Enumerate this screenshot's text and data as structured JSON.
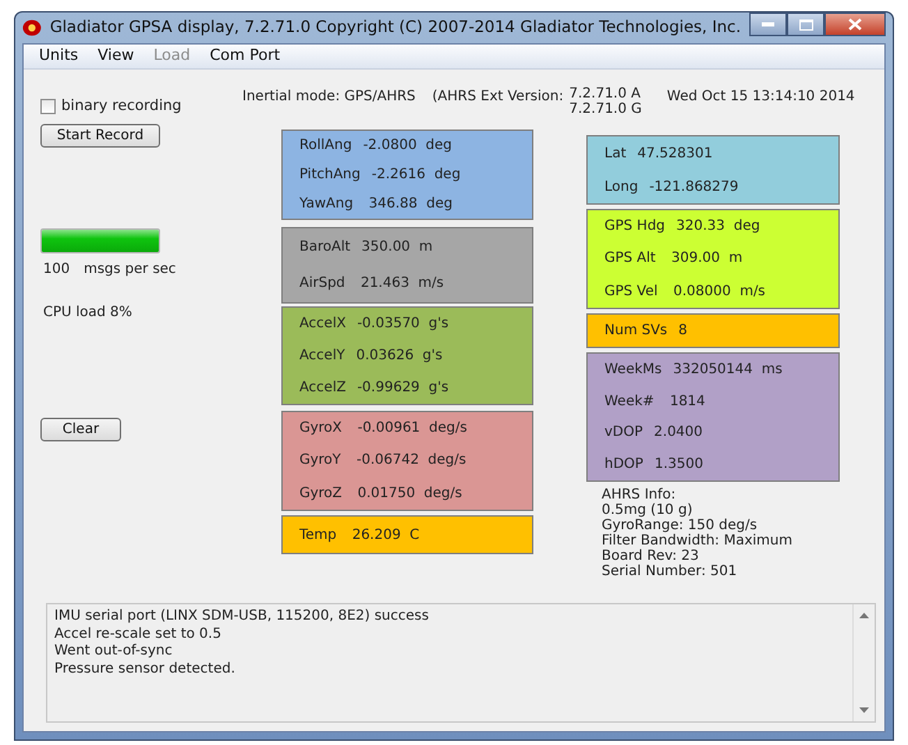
{
  "window": {
    "title": "Gladiator GPSA display, 7.2.71.0 Copyright (C) 2007-2014 Gladiator Technologies, Inc."
  },
  "menu": [
    {
      "label": "Units",
      "disabled": false
    },
    {
      "label": "View",
      "disabled": false
    },
    {
      "label": "Load",
      "disabled": true
    },
    {
      "label": "Com Port",
      "disabled": false
    }
  ],
  "binary_recording": {
    "label": "binary recording",
    "checked": false
  },
  "start_button": "Start Record",
  "header": {
    "mode": "Inertial mode: GPS/AHRS",
    "version_label": "(AHRS Ext Version:",
    "versions": [
      "7.2.71.0 A",
      "7.2.71.0 G"
    ],
    "date": "Wed Oct 15 13:14:10 2014"
  },
  "rate": {
    "level": 1,
    "count": "100",
    "unit": "msgs per sec"
  },
  "cpu_load": "CPU load  8%",
  "clear_button": "Clear",
  "left_groups": [
    {
      "color": "#8db4e2",
      "rows": [
        {
          "label": "RollAng",
          "reading": "-2.0800  deg"
        },
        {
          "label": "PitchAng",
          "reading": "-2.2616  deg"
        },
        {
          "label": "YawAng",
          "reading": " 346.88  deg"
        }
      ]
    },
    {
      "color": "#a6a6a6",
      "rows": [
        {
          "label": "BaroAlt",
          "reading": "350.00  m"
        },
        {
          "label": "AirSpd",
          "reading": " 21.463  m/s"
        }
      ]
    },
    {
      "color": "#9bbb59",
      "rows": [
        {
          "label": "AccelX",
          "reading": "-0.03570  g's"
        },
        {
          "label": "AccelY",
          "reading": "0.03626  g's"
        },
        {
          "label": "AccelZ",
          "reading": "-0.99629  g's"
        }
      ]
    },
    {
      "color": "#da9694",
      "rows": [
        {
          "label": "GyroX",
          "reading": " -0.00961  deg/s"
        },
        {
          "label": "GyroY",
          "reading": " -0.06742  deg/s"
        },
        {
          "label": "GyroZ",
          "reading": " 0.01750  deg/s"
        }
      ]
    },
    {
      "color": "#ffc000",
      "rows": [
        {
          "label": "Temp",
          "reading": " 26.209  C"
        }
      ]
    }
  ],
  "right_groups": [
    {
      "color": "#92cddc",
      "rows": [
        {
          "label": "Lat",
          "reading": "47.528301"
        },
        {
          "label": "Long",
          "reading": "-121.868279"
        }
      ]
    },
    {
      "color": "#ccff33",
      "rows": [
        {
          "label": "GPS Hdg",
          "reading": "320.33  deg"
        },
        {
          "label": "GPS Alt",
          "reading": " 309.00  m"
        },
        {
          "label": "GPS Vel",
          "reading": " 0.08000  m/s"
        }
      ]
    },
    {
      "color": "#ffc000",
      "rows": [
        {
          "label": "Num SVs",
          "reading": "8"
        }
      ]
    },
    {
      "color": "#b1a0c7",
      "rows": [
        {
          "label": "WeekMs",
          "reading": "332050144  ms"
        },
        {
          "label": "Week#",
          "reading": " 1814"
        },
        {
          "label": "vDOP",
          "reading": "2.0400"
        },
        {
          "label": "hDOP",
          "reading": "1.3500"
        }
      ]
    }
  ],
  "ahrs_info": [
    "AHRS Info:",
    "0.5mg (10 g)",
    "GyroRange:  150 deg/s",
    "Filter Bandwidth: Maximum",
    "Board Rev: 23",
    "Serial Number: 501"
  ],
  "log": [
    "IMU serial port (LINX SDM-USB, 115200,  8E2) success",
    "Accel re-scale set to 0.5",
    "Went out-of-sync",
    "Pressure sensor detected."
  ]
}
